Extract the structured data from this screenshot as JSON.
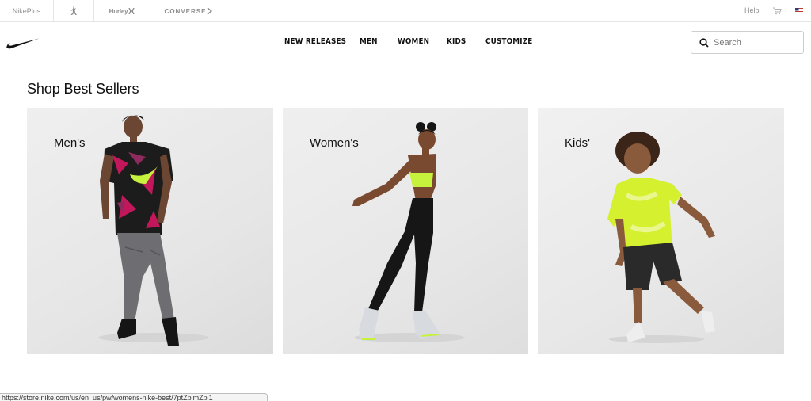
{
  "topbar": {
    "brands": [
      {
        "label": "NikePlus"
      },
      {
        "label": "",
        "icon": "jordan-jumpman-icon"
      },
      {
        "label": "Hurley",
        "icon": "hurley-logo-icon"
      },
      {
        "label": "CONVERSE",
        "icon": "converse-logo-icon"
      }
    ],
    "help_label": "Help",
    "cart_icon": "cart-icon",
    "flag_icon": "us-flag-icon"
  },
  "nav": {
    "logo_icon": "nike-swoosh-icon",
    "links": [
      {
        "label": "NEW RELEASES"
      },
      {
        "label": "MEN"
      },
      {
        "label": "WOMEN"
      },
      {
        "label": "KIDS"
      },
      {
        "label": "CUSTOMIZE"
      }
    ],
    "search": {
      "placeholder": "Search",
      "value": "",
      "icon": "search-icon"
    }
  },
  "main": {
    "section_title": "Shop Best Sellers",
    "cards": [
      {
        "label": "Men's"
      },
      {
        "label": "Women's"
      },
      {
        "label": "Kids'"
      }
    ]
  },
  "status_bar": {
    "url": "https://store.nike.com/us/en_us/pw/womens-nike-best/7ptZpimZpi1"
  },
  "colors": {
    "text": "#111111",
    "muted": "#8d8d8d",
    "border": "#e5e5e5",
    "accent_volt": "#d7f33c"
  }
}
